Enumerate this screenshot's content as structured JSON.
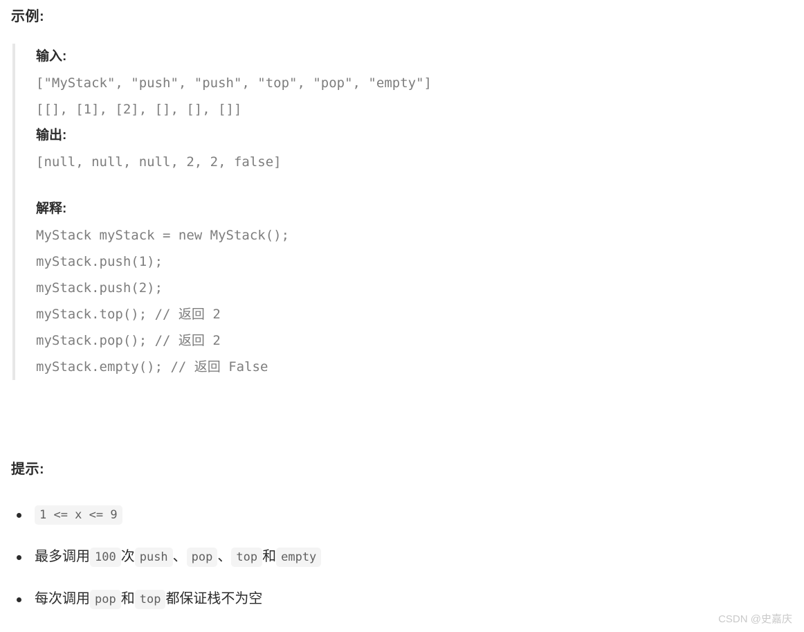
{
  "page": {
    "background_color": "#ffffff",
    "text_color": "#2b2b2b",
    "code_color": "#7d7d7d",
    "chip_bg_color": "#f4f4f4",
    "blockquote_border_color": "#e7e7e7",
    "watermark_color": "#c9c9c9"
  },
  "example_section": {
    "heading": "示例:",
    "blockquote": {
      "input_label": "输入:",
      "input_lines": [
        "[\"MyStack\", \"push\", \"push\", \"top\", \"pop\", \"empty\"]",
        "[[], [1], [2], [], [], []]"
      ],
      "output_label": "输出:",
      "output_lines": [
        "[null, null, null, 2, 2, false]"
      ],
      "explanation_label": "解释:",
      "explanation_lines": [
        "MyStack myStack = new MyStack();",
        "myStack.push(1);",
        "myStack.push(2);",
        "myStack.top(); // 返回 2",
        "myStack.pop(); // 返回 2",
        "myStack.empty(); // 返回 False"
      ]
    }
  },
  "hints_section": {
    "heading": "提示:",
    "items": [
      {
        "parts": [
          {
            "type": "code",
            "text": "1 <= x <= 9"
          }
        ]
      },
      {
        "parts": [
          {
            "type": "text",
            "text": "最多调用"
          },
          {
            "type": "code",
            "text": "100"
          },
          {
            "type": "text",
            "text": " 次 "
          },
          {
            "type": "code",
            "text": "push"
          },
          {
            "type": "text",
            "text": "、"
          },
          {
            "type": "code",
            "text": "pop"
          },
          {
            "type": "text",
            "text": "、"
          },
          {
            "type": "code",
            "text": "top"
          },
          {
            "type": "text",
            "text": " 和 "
          },
          {
            "type": "code",
            "text": "empty"
          }
        ]
      },
      {
        "parts": [
          {
            "type": "text",
            "text": "每次调用 "
          },
          {
            "type": "code",
            "text": "pop"
          },
          {
            "type": "text",
            "text": " 和 "
          },
          {
            "type": "code",
            "text": "top"
          },
          {
            "type": "text",
            "text": " 都保证栈不为空"
          }
        ]
      }
    ]
  },
  "watermark": {
    "text": "CSDN @史嘉庆"
  }
}
